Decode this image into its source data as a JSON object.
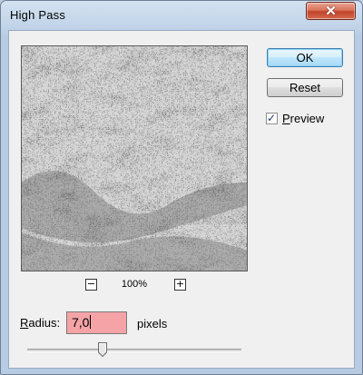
{
  "window": {
    "title": "High Pass",
    "close_glyph": "✕"
  },
  "preview": {
    "zoom_out_glyph": "−",
    "zoom_in_glyph": "+",
    "zoom_level": "100%"
  },
  "buttons": {
    "ok_label": "OK",
    "reset_label": "Reset"
  },
  "preview_checkbox": {
    "checked": true,
    "check_glyph": "✓",
    "label_first": "P",
    "label_rest": "review"
  },
  "radius": {
    "label_first": "R",
    "label_rest": "adius:",
    "value": "7,0",
    "units": "pixels",
    "slider_fraction": 0.35,
    "input_highlight": "#f5a3a6"
  },
  "icons": {
    "close": "close-icon",
    "zoom_out": "zoom-out-icon",
    "zoom_in": "zoom-in-icon",
    "check": "check-icon",
    "slider_thumb": "slider-thumb-icon"
  }
}
